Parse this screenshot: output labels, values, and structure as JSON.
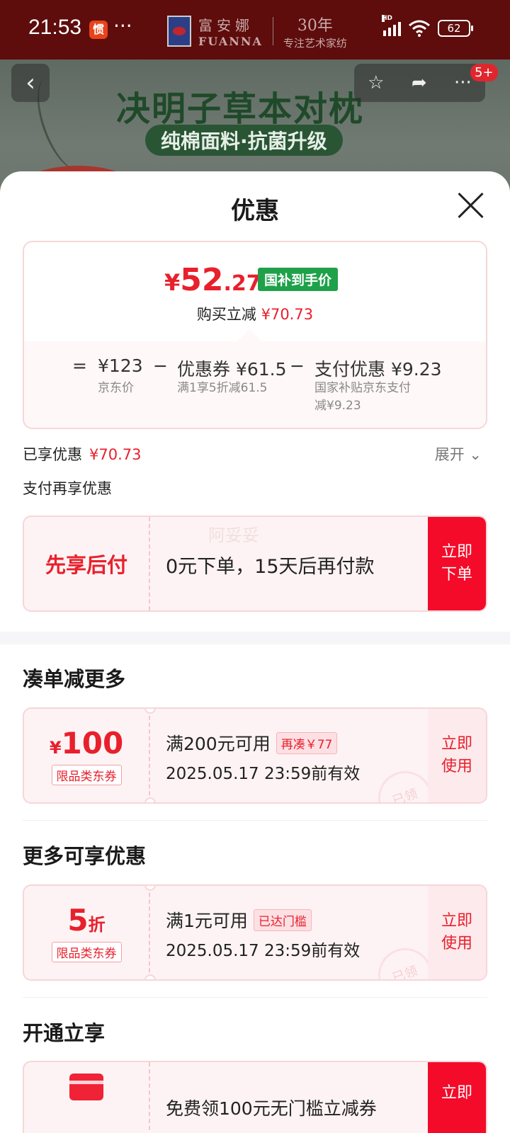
{
  "status": {
    "time": "21:53",
    "app_icon_text": "惯",
    "dots": "···",
    "network": "HD",
    "battery": "62"
  },
  "brand": {
    "name_cn": "富安娜",
    "name_en": "FUANNA",
    "years": "30年",
    "slogan": "专注艺术家纺"
  },
  "banner": {
    "title": "决明子草本对枕",
    "subtitle": "纯棉面料·抗菌升级",
    "cart_badge": "5+"
  },
  "sheet": {
    "title": "优惠"
  },
  "price": {
    "currency": "¥",
    "integer": "52",
    "decimal": ".27",
    "tag": "国补到手价",
    "save_label": "购买立减",
    "save_amount": "¥70.73",
    "eq": "=",
    "jd_price": "¥123",
    "jd_price_label": "京东价",
    "minus1": "−",
    "coupon": "优惠券 ¥61.5",
    "coupon_desc": "满1享5折减61.5",
    "minus2": "−",
    "pay_discount": "支付优惠 ¥9.23",
    "pay_discount_desc1": "国家补贴京东支付",
    "pay_discount_desc2": "减¥9.23"
  },
  "enjoyed": {
    "label": "已享优惠",
    "amount": "¥70.73",
    "expand": "展开"
  },
  "pay_more_label": "支付再享优惠",
  "bnpl": {
    "title": "先享后付",
    "desc": "0元下单，15天后再付款",
    "watermark": "阿妥妥",
    "button_line1": "立即",
    "button_line2": "下单"
  },
  "sections": {
    "more_order": "凑单减更多",
    "more_discounts": "更多可享优惠",
    "open_enjoy": "开通立享"
  },
  "coupon1": {
    "currency": "¥",
    "amount": "100",
    "type": "限品类东券",
    "condition": "满200元可用",
    "chip": "再凑￥77",
    "validity": "2025.05.17  23:59前有效",
    "stamp": "已领",
    "button_line1": "立即",
    "button_line2": "使用"
  },
  "coupon2": {
    "amount": "5",
    "unit": "折",
    "type": "限品类东券",
    "condition": "满1元可用",
    "chip": "已达门槛",
    "validity": "2025.05.17  23:59前有效",
    "stamp": "已领",
    "button_line1": "立即",
    "button_line2": "使用"
  },
  "open_card": {
    "desc": "免费领100元无门槛立减券",
    "button_line1": "立即"
  },
  "colors": {
    "accent_red": "#e8202c",
    "button_red": "#f40b2a",
    "tag_green": "#1fa14a",
    "status_bg": "#5e0c0c"
  }
}
